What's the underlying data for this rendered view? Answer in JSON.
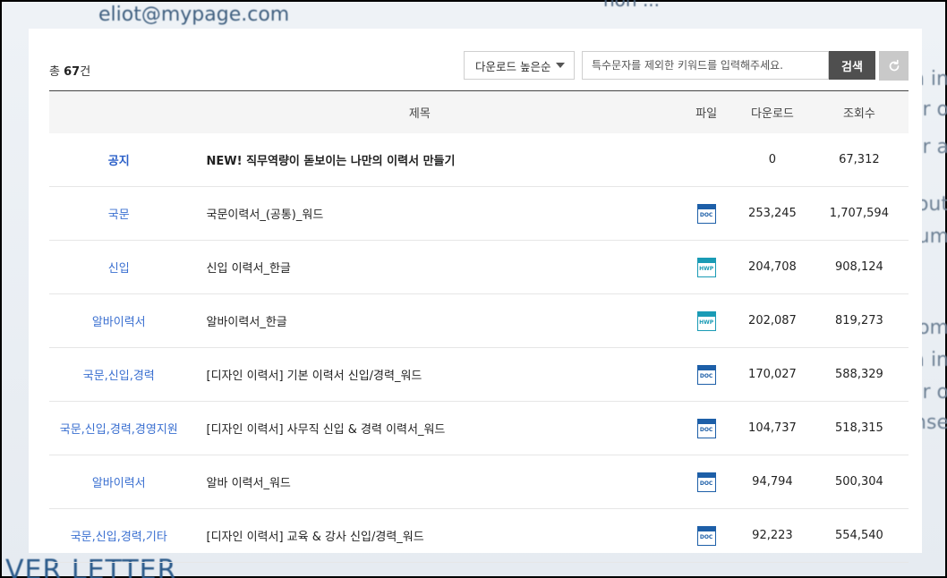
{
  "background": {
    "email": "eliot@mypage.com",
    "top_fragment": "non ...",
    "cover_text": "VER LETTER",
    "right_fragments": [
      "n in",
      "r o",
      "ur a",
      "out",
      "um",
      "com",
      "a in",
      "r o",
      "nse"
    ]
  },
  "toolbar": {
    "total_prefix": "총 ",
    "total_count": "67",
    "total_suffix": "건",
    "sort_selected": "다운로드 높은순",
    "search_placeholder": "특수문자를 제외한 키워드를 입력해주세요.",
    "search_button": "검색",
    "reset_icon": "refresh-icon"
  },
  "table": {
    "headers": {
      "title": "제목",
      "file": "파일",
      "downloads": "다운로드",
      "views": "조회수"
    },
    "rows": [
      {
        "category": "공지",
        "title": "NEW! 직무역량이 돋보이는 나만의 이력서 만들기",
        "file": "",
        "downloads": "0",
        "views": "67,312"
      },
      {
        "category": "국문",
        "title": "국문이력서_(공통)_워드",
        "file": "DOC",
        "downloads": "253,245",
        "views": "1,707,594"
      },
      {
        "category": "신입",
        "title": "신입 이력서_한글",
        "file": "HWP",
        "downloads": "204,708",
        "views": "908,124"
      },
      {
        "category": "알바이력서",
        "title": "알바이력서_한글",
        "file": "HWP",
        "downloads": "202,087",
        "views": "819,273"
      },
      {
        "category": "국문,신입,경력",
        "title": "[디자인 이력서] 기본 이력서 신입/경력_워드",
        "file": "DOC",
        "downloads": "170,027",
        "views": "588,329"
      },
      {
        "category": "국문,신입,경력,경영지원",
        "title": "[디자인 이력서] 사무직 신입 & 경력 이력서_워드",
        "file": "DOC",
        "downloads": "104,737",
        "views": "518,315"
      },
      {
        "category": "알바이력서",
        "title": "알바 이력서_워드",
        "file": "DOC",
        "downloads": "94,794",
        "views": "500,304"
      },
      {
        "category": "국문,신입,경력,기타",
        "title": "[디자인 이력서] 교육 & 강사 신입/경력_워드",
        "file": "DOC",
        "downloads": "92,223",
        "views": "554,540"
      }
    ]
  },
  "colors": {
    "doc_icon": "#1d5fa8",
    "hwp_icon": "#1a9bb5",
    "category_link": "#3a6fd0",
    "search_button_bg": "#4f4f4f",
    "reset_button_bg": "#c9c9c9"
  }
}
